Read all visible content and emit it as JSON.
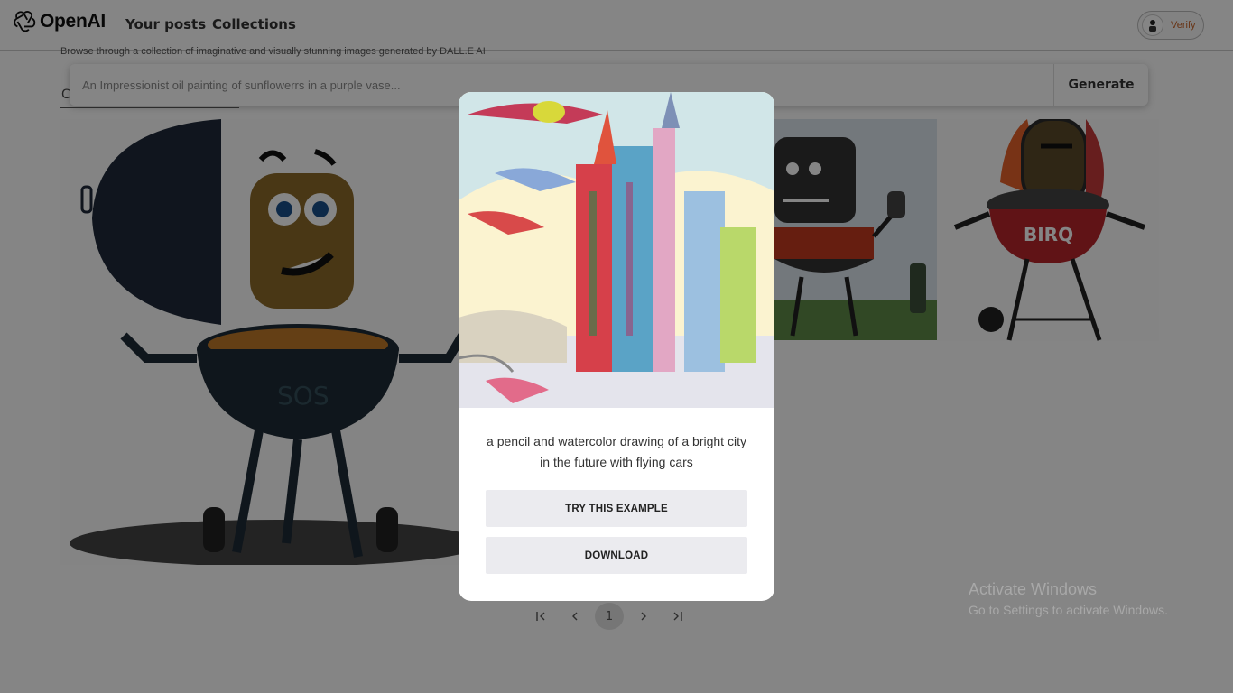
{
  "header": {
    "logo_text": "OpenAI",
    "nav": [
      {
        "label": "Your posts"
      },
      {
        "label": "Collections"
      }
    ],
    "verify_label": "Verify"
  },
  "page": {
    "subtitle": "Browse through a collection of imaginative and visually stunning images generated by DALL.E AI",
    "tab_letter": "C"
  },
  "search": {
    "placeholder": "An Impressionist oil painting of sunflowerrs in a purple vase...",
    "value": "",
    "generate_label": "Generate"
  },
  "gallery": {
    "tile_1_text": "SOS",
    "tile_4_text": "BIRQ"
  },
  "pagination": {
    "first_icon": "first-page-icon",
    "prev_icon": "chevron-left-icon",
    "current": "1",
    "next_icon": "chevron-right-icon",
    "last_icon": "last-page-icon"
  },
  "modal": {
    "caption": "a pencil and watercolor drawing of a bright city in the future with flying cars",
    "try_label": "TRY THIS EXAMPLE",
    "download_label": "DOWNLOAD"
  },
  "watermark": {
    "line1": "Activate Windows",
    "line2": "Go to Settings to activate Windows."
  },
  "colors": {
    "overlay": "#000000",
    "verify_text": "#c8642a",
    "modal_button_bg": "#ebebef"
  }
}
